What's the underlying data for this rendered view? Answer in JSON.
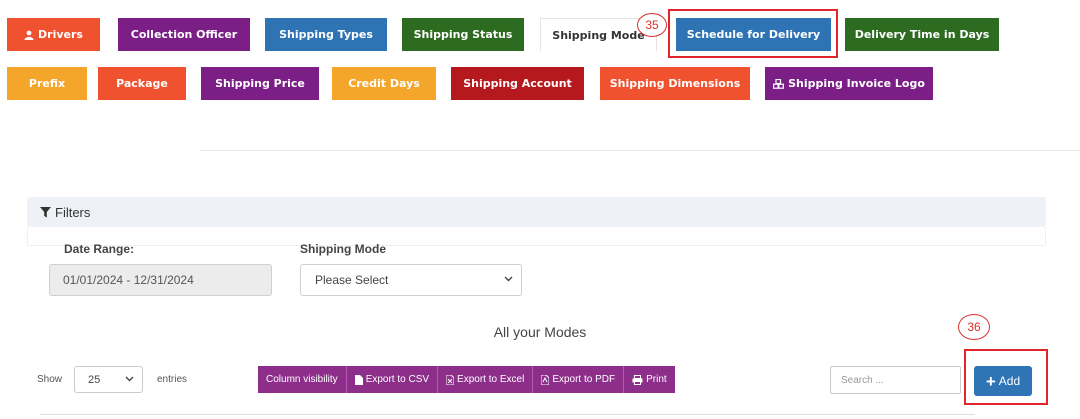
{
  "tabs": [
    {
      "label": "Drivers",
      "color": "#f0522f",
      "icon": "user-icon"
    },
    {
      "label": "Collection Officer",
      "color": "#7b1f86"
    },
    {
      "label": "Shipping Types",
      "color": "#2e74b5"
    },
    {
      "label": "Shipping Status",
      "color": "#2d6b21"
    },
    {
      "label": "Shipping Mode",
      "color": "#ffffff",
      "active": true
    },
    {
      "label": "Schedule for Delivery",
      "color": "#2e74b5"
    },
    {
      "label": "Delivery Time in Days",
      "color": "#2d6b21"
    },
    {
      "label": "Prefix",
      "color": "#f4a62a"
    },
    {
      "label": "Package",
      "color": "#f0522f"
    },
    {
      "label": "Shipping Price",
      "color": "#7b1f86"
    },
    {
      "label": "Credit Days",
      "color": "#f4a62a"
    },
    {
      "label": "Shipping Account",
      "color": "#b5181d"
    },
    {
      "label": "Shipping Dimensions",
      "color": "#f0522f"
    },
    {
      "label": "Shipping Invoice Logo",
      "color": "#7b1f86",
      "icon": "cubes-icon"
    }
  ],
  "annotations": {
    "step_35": "35",
    "step_36": "36",
    "color": "#e0262b"
  },
  "filters": {
    "title": "Filters",
    "date_range_label": "Date Range:",
    "date_range_value": "01/01/2024 - 12/31/2024",
    "shipping_mode_label": "Shipping Mode",
    "shipping_mode_value": "Please Select"
  },
  "table": {
    "title": "All your Modes",
    "show_label": "Show",
    "entries_value": "25",
    "entries_label": "entries",
    "buttons": [
      "Column visibility",
      "Export to CSV",
      "Export to Excel",
      "Export to PDF",
      "Print"
    ],
    "search_placeholder": "Search ...",
    "add_label": "Add"
  }
}
